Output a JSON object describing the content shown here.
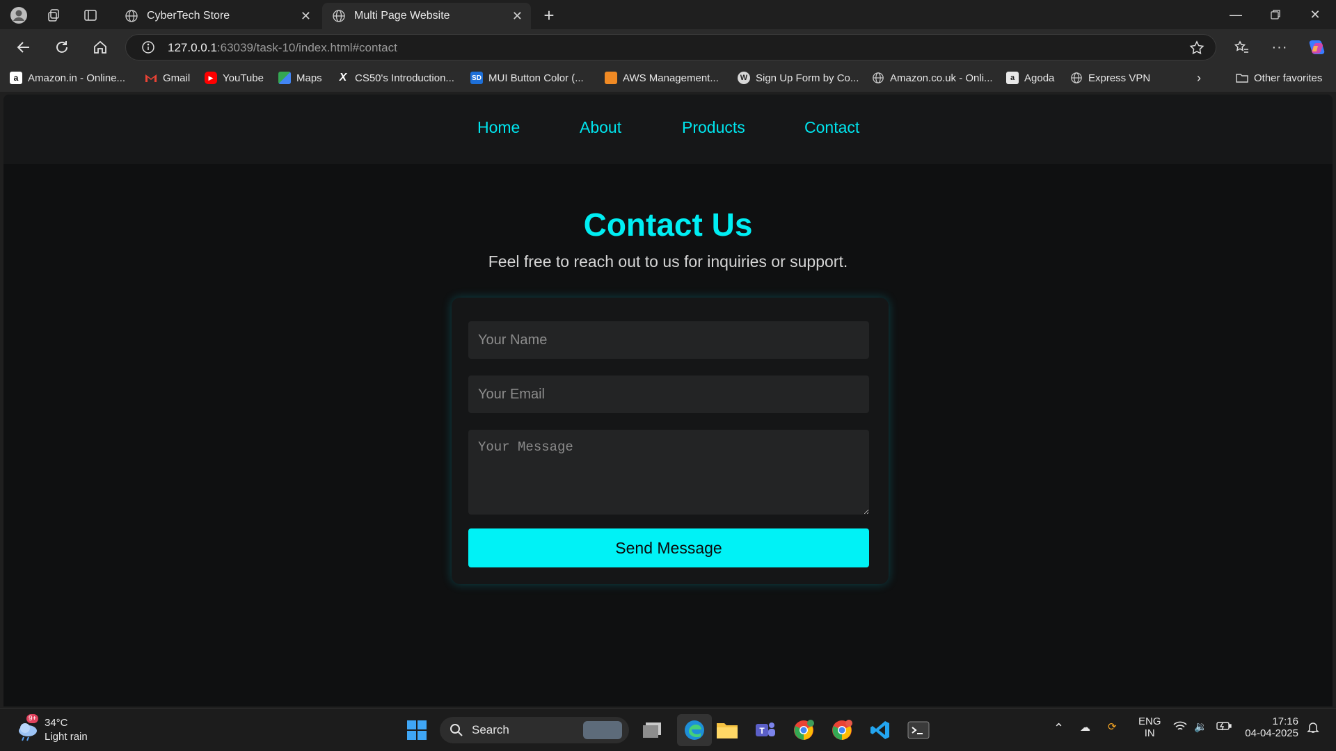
{
  "browser": {
    "tabs": [
      {
        "label": "CyberTech Store",
        "active": false
      },
      {
        "label": "Multi Page Website",
        "active": true
      }
    ],
    "url_host": "127.0.0.1",
    "url_rest": ":63039/task-10/index.html#contact",
    "bookmarks": [
      {
        "label": "Amazon.in - Online..."
      },
      {
        "label": "Gmail"
      },
      {
        "label": "YouTube"
      },
      {
        "label": "Maps"
      },
      {
        "label": "CS50's Introduction..."
      },
      {
        "label": "MUI Button Color (..."
      },
      {
        "label": "AWS Management..."
      },
      {
        "label": "Sign Up Form by Co..."
      },
      {
        "label": "Amazon.co.uk - Onli..."
      },
      {
        "label": "Agoda"
      },
      {
        "label": "Express VPN"
      }
    ],
    "other_favorites": "Other favorites"
  },
  "site": {
    "nav": [
      "Home",
      "About",
      "Products",
      "Contact"
    ],
    "title": "Contact Us",
    "subtitle": "Feel free to reach out to us for inquiries or support.",
    "form": {
      "name_placeholder": "Your Name",
      "email_placeholder": "Your Email",
      "message_placeholder": "Your Message",
      "submit_label": "Send Message"
    },
    "accent_color": "#00f2f6"
  },
  "taskbar": {
    "weather_temp": "34°C",
    "weather_desc": "Light rain",
    "weather_badge": "9+",
    "search_label": "Search",
    "lang": "ENG",
    "region": "IN",
    "time": "17:16",
    "date": "04-04-2025"
  }
}
